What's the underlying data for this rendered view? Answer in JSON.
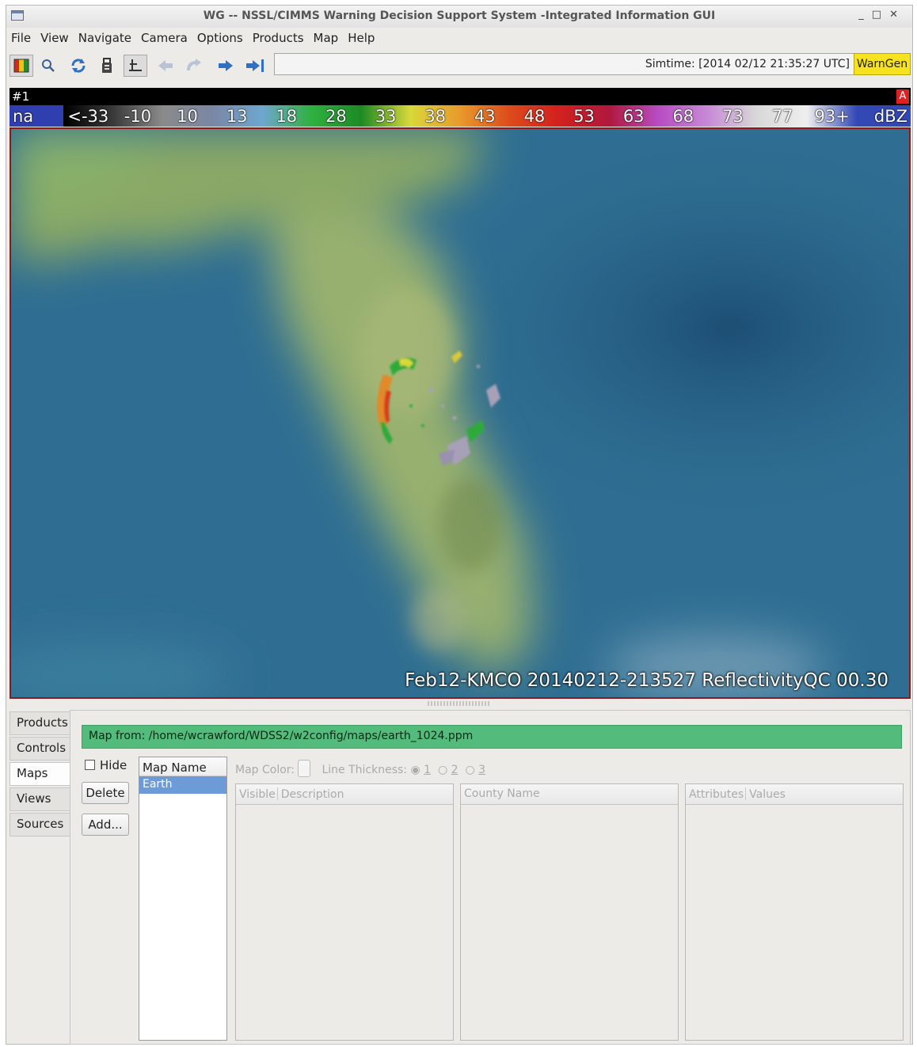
{
  "window": {
    "title": "WG -- NSSL/CIMMS Warning Decision Support System -Integrated Information GUI"
  },
  "menu": [
    "File",
    "View",
    "Navigate",
    "Camera",
    "Options",
    "Products",
    "Map",
    "Help"
  ],
  "toolbar": {
    "icons": [
      "colormap-icon",
      "zoom-icon",
      "refresh-icon",
      "lock-icon",
      "pick-tool-icon",
      "back-arrow-icon",
      "undo-arrow-icon",
      "forward-arrow-icon",
      "latest-arrow-icon"
    ],
    "simtime": "Simtime: [2014 02/12 21:35:27 UTC]",
    "warngen": "WarnGen"
  },
  "pane": {
    "label": "#1",
    "alarm": "A"
  },
  "colorbar": {
    "labels": [
      "na",
      "<-33",
      "-10",
      "10",
      "13",
      "18",
      "28",
      "33",
      "38",
      "43",
      "48",
      "53",
      "63",
      "68",
      "73",
      "77",
      "93+",
      "dBZ"
    ],
    "colors": [
      "#2f3fb0",
      "#000000",
      "#3a3a3a",
      "#8a8a8a",
      "#7a87a4",
      "#6fa6cf",
      "#30b040",
      "#1c8a24",
      "#d8d83a",
      "#e89a2c",
      "#dd4a1c",
      "#d2201e",
      "#b0183c",
      "#b84cc4",
      "#c78ad6",
      "#d9d9d9",
      "#eeeeee",
      "#3348b5"
    ]
  },
  "map": {
    "caption": "Feb12-KMCO 20140212-213527 ReflectivityQC 00.30"
  },
  "tabs": [
    "Products",
    "Controls",
    "Maps",
    "Views",
    "Sources"
  ],
  "maps_panel": {
    "map_from": "Map from: /home/wcrawford/WDSS2/w2config/maps/earth_1024.ppm",
    "hide_label": "Hide",
    "delete_label": "Delete",
    "add_label": "Add...",
    "map_name_header": "Map Name",
    "maps": [
      "Earth"
    ],
    "map_color_label": "Map Color:",
    "line_thickness_label": "Line Thickness:",
    "thickness_options": [
      "1",
      "2",
      "3"
    ],
    "selected_thickness": "1",
    "table1_headers": [
      "Visible",
      "Description"
    ],
    "table2_headers": [
      "County Name"
    ],
    "table3_headers": [
      "Attributes",
      "Values"
    ]
  }
}
